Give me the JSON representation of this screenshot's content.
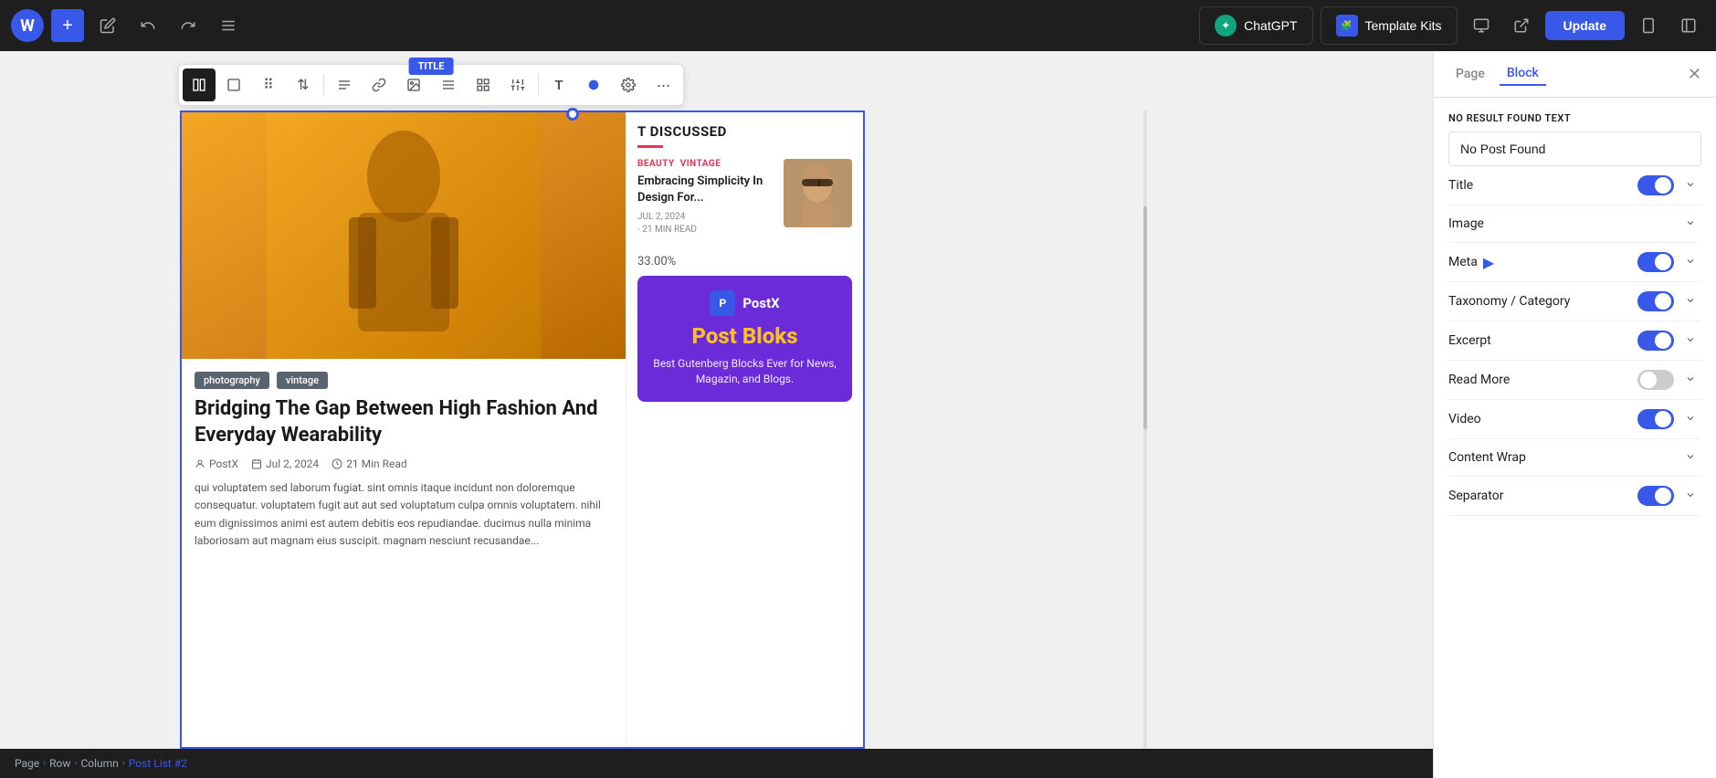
{
  "topbar": {
    "wp_logo": "W",
    "add_btn": "+",
    "edit_icon": "✎",
    "undo_icon": "↩",
    "redo_icon": "↪",
    "menu_icon": "≡",
    "chatgpt_label": "ChatGPT",
    "template_kits_label": "Template Kits",
    "update_btn_label": "Update",
    "device_desktop_icon": "⬜",
    "device_preview_icon": "⎋",
    "layout_icon": "⊞",
    "sidebar_icon": "▣"
  },
  "toolbar": {
    "title_label": "TITLE",
    "icon_columns": "⊞",
    "icon_move": "⠿",
    "icon_reorder": "⇅",
    "icon_align": "≡",
    "icon_link": "🔗",
    "icon_image": "🖼",
    "icon_text_align": "☰",
    "icon_table": "⊞",
    "icon_settings": "⚙",
    "icon_text_style": "T",
    "icon_color": "◉",
    "icon_gear": "⚙",
    "icon_more": "•••"
  },
  "canvas": {
    "section_heading": "T DISCUSSED",
    "accent_color": "#e8325a",
    "left_post": {
      "tags": [
        "photography",
        "vintage"
      ],
      "title": "Bridging The Gap Between High Fashion And Everyday Wearability",
      "author": "PostX",
      "date": "Jul 2, 2024",
      "read_time": "21 Min Read",
      "excerpt": "qui voluptatem sed laborum fugiat. sint omnis itaque incidunt non doloremque consequatur. voluptatem fugit aut aut sed voluptatum culpa omnis voluptatem. nihil eum dignissimos animi est autem debitis eos repudiandae. ducimus nulla minima laboriosam aut magnam eius suscipit. magnam nesciunt recusandae..."
    },
    "right_section": {
      "categories": [
        "BEAUTY",
        "VINTAGE"
      ],
      "post_title": "Embracing Simplicity In Design For...",
      "post_date": "JUL 2, 2024",
      "post_read": "- 21 MIN READ",
      "percentage": "33.00%",
      "postx_ad_title": "Post Bloks",
      "postx_ad_sub": "Best Gutenberg Blocks Ever for News, Magazin, and Blogs."
    }
  },
  "right_panel": {
    "tab_page": "Page",
    "tab_block": "Block",
    "active_tab": "Block",
    "close_icon": "✕",
    "no_result_label": "NO RESULT FOUND TEXT",
    "no_result_placeholder": "No Post Found",
    "rows": [
      {
        "id": "title",
        "label": "Title",
        "toggle": true,
        "has_chevron": true,
        "has_play": false
      },
      {
        "id": "image",
        "label": "Image",
        "toggle": false,
        "has_chevron": true,
        "has_play": false
      },
      {
        "id": "meta",
        "label": "Meta",
        "toggle": true,
        "has_chevron": true,
        "has_play": true
      },
      {
        "id": "taxonomy",
        "label": "Taxonomy / Category",
        "toggle": true,
        "has_chevron": true,
        "has_play": false
      },
      {
        "id": "excerpt",
        "label": "Excerpt",
        "toggle": true,
        "has_chevron": true,
        "has_play": false
      },
      {
        "id": "read_more",
        "label": "Read More",
        "toggle": false,
        "has_chevron": true,
        "has_play": false
      },
      {
        "id": "video",
        "label": "Video",
        "toggle": true,
        "has_chevron": true,
        "has_play": false
      },
      {
        "id": "content_wrap",
        "label": "Content Wrap",
        "toggle": false,
        "has_chevron": true,
        "has_play": false
      },
      {
        "id": "separator",
        "label": "Separator",
        "toggle": true,
        "has_chevron": true,
        "has_play": false
      }
    ]
  },
  "breadcrumb": {
    "items": [
      "Page",
      "Row",
      "Column",
      "Post List #2"
    ],
    "separators": [
      ">",
      ">",
      ">"
    ]
  }
}
